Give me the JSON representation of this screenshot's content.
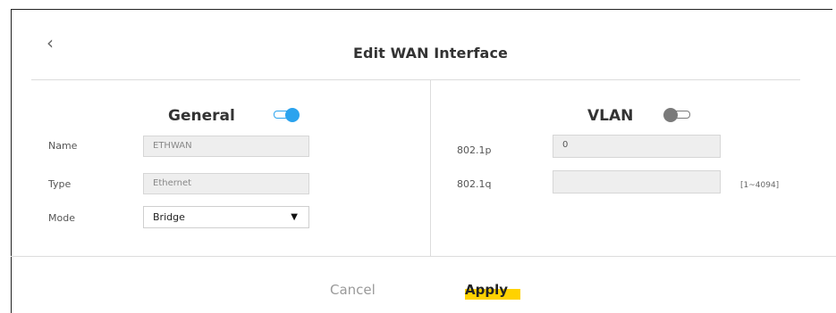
{
  "dialog": {
    "title": "Edit WAN Interface"
  },
  "general": {
    "title": "General",
    "toggle_on": true,
    "fields": {
      "name_label": "Name",
      "name_value": "ETHWAN",
      "type_label": "Type",
      "type_value": "Ethernet",
      "mode_label": "Mode",
      "mode_value": "Bridge"
    }
  },
  "vlan": {
    "title": "VLAN",
    "toggle_on": false,
    "fields": {
      "p_label": "802.1p",
      "p_value": "0",
      "q_label": "802.1q",
      "q_value": "",
      "q_hint": "[1~4094]"
    }
  },
  "footer": {
    "cancel_label": "Cancel",
    "apply_label": "Apply"
  },
  "colors": {
    "accent": "#2ba3ee",
    "toggle_off": "#7a7a7a",
    "highlight": "#ffd200"
  },
  "icons": {
    "back": "chevron-left-icon",
    "dropdown": "triangle-down-icon"
  }
}
